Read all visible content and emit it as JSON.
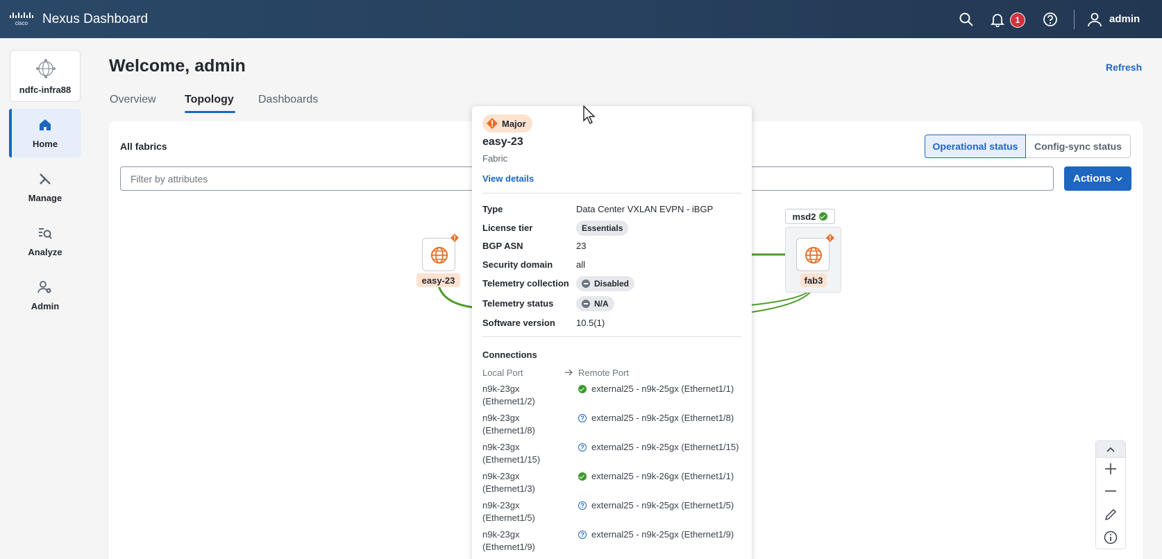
{
  "header": {
    "brand": "cisco",
    "app_title": "Nexus Dashboard",
    "notifications_count": "1",
    "user": "admin",
    "icons": [
      "search-icon",
      "bell-icon",
      "help-icon",
      "user-icon"
    ]
  },
  "sidebar": {
    "site_name": "ndfc-infra88",
    "items": [
      {
        "label": "Home",
        "icon": "home-icon",
        "active": true
      },
      {
        "label": "Manage",
        "icon": "tools-icon",
        "active": false
      },
      {
        "label": "Analyze",
        "icon": "analyze-icon",
        "active": false
      },
      {
        "label": "Admin",
        "icon": "admin-icon",
        "active": false
      }
    ]
  },
  "main": {
    "welcome": "Welcome, admin",
    "refresh": "Refresh",
    "tabs": [
      {
        "label": "Overview",
        "active": false
      },
      {
        "label": "Topology",
        "active": true
      },
      {
        "label": "Dashboards",
        "active": false
      }
    ],
    "panel_title": "All fabrics",
    "status_toggle": {
      "operational": "Operational status",
      "config_sync": "Config-sync status",
      "selected": "operational"
    },
    "filter_placeholder": "Filter by attributes",
    "actions": "Actions"
  },
  "topology": {
    "nodes": [
      {
        "label": "easy-23",
        "severity": "major"
      },
      {
        "label": "fab3",
        "severity": "major"
      }
    ],
    "group": {
      "label": "msd2",
      "status": "healthy"
    }
  },
  "popover": {
    "severity": "Major",
    "name": "easy-23",
    "kind": "Fabric",
    "view_details": "View details",
    "properties": {
      "type": {
        "k": "Type",
        "v": "Data Center VXLAN EVPN - iBGP"
      },
      "license": {
        "k": "License tier",
        "v": "Essentials"
      },
      "bgp": {
        "k": "BGP ASN",
        "v": "23"
      },
      "security": {
        "k": "Security domain",
        "v": "all"
      },
      "telemetry_collection": {
        "k": "Telemetry collection",
        "v": "Disabled"
      },
      "telemetry_status": {
        "k": "Telemetry status",
        "v": "N/A"
      },
      "software": {
        "k": "Software version",
        "v": "10.5(1)"
      }
    },
    "connections_title": "Connections",
    "local_port_header": "Local Port",
    "remote_port_header": "Remote Port",
    "connections": [
      {
        "local": "n9k-23gx (Ethernet1/2)",
        "remote": "external25 - n9k-25gx (Ethernet1/1)",
        "status": "up"
      },
      {
        "local": "n9k-23gx (Ethernet1/8)",
        "remote": "external25 - n9k-25gx (Ethernet1/8)",
        "status": "unknown"
      },
      {
        "local": "n9k-23gx (Ethernet1/15)",
        "remote": "external25 - n9k-25gx (Ethernet1/15)",
        "status": "unknown"
      },
      {
        "local": "n9k-23gx (Ethernet1/3)",
        "remote": "external25 - n9k-26gx (Ethernet1/1)",
        "status": "up"
      },
      {
        "local": "n9k-23gx (Ethernet1/5)",
        "remote": "external25 - n9k-25gx (Ethernet1/5)",
        "status": "unknown"
      },
      {
        "local": "n9k-23gx (Ethernet1/9)",
        "remote": "external25 - n9k-25gx (Ethernet1/9)",
        "status": "unknown"
      }
    ]
  },
  "zoom_controls": [
    "collapse-icon",
    "zoom-in-icon",
    "zoom-out-icon",
    "edit-icon",
    "info-icon"
  ],
  "colors": {
    "accent": "#1d66c2",
    "header": "#263f5c",
    "major": "#e8702a",
    "ok": "#3c9a2d",
    "link_line": "#4f9a2a"
  }
}
